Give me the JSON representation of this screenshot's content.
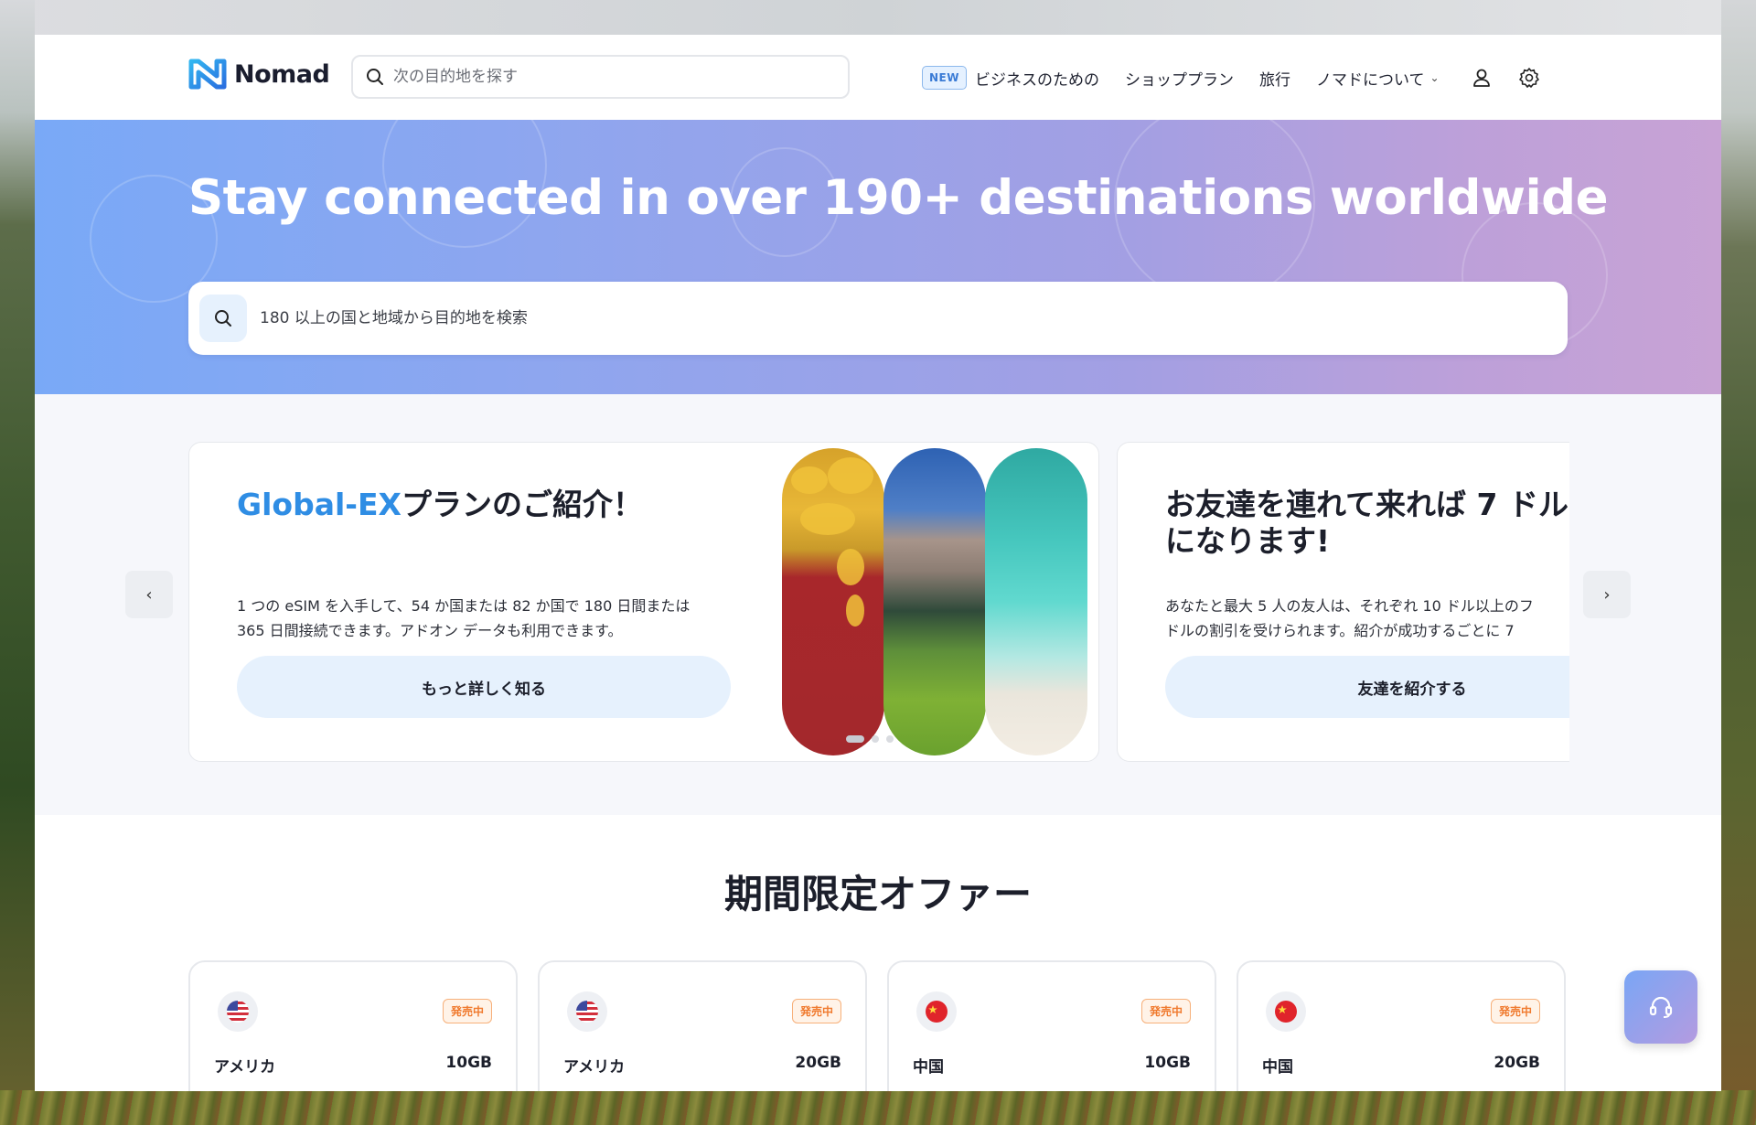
{
  "brand": {
    "name": "Nomad",
    "accent": "#2f8de4"
  },
  "header": {
    "search_placeholder": "次の目的地を探す",
    "new_badge": "NEW",
    "nav": [
      "ビジネスのための",
      "ショッププラン",
      "旅行",
      "ノマドについて"
    ]
  },
  "hero": {
    "title": "Stay connected in over 190+ destinations worldwide",
    "search_placeholder": "180 以上の国と地域から目的地を検索"
  },
  "promos": [
    {
      "title_accent": "Global-EX",
      "title_rest": "プランのご紹介！",
      "desc_line1": "1 つの eSIM を入手して、54 か国または 82 か国で 180 日間または",
      "desc_line2": "365 日間接続できます。アドオン データも利用できます。",
      "button": "もっと詳しく知る"
    },
    {
      "title_line1": "お友達を連れて来れば 7 ドル",
      "title_line2": "になります!",
      "desc_line1": "あなたと最大 5 人の友人は、それぞれ 10 ドル以上のフ",
      "desc_line2": "ドルの割引を受けられます。紹介が成功するごとに 7",
      "button": "友達を紹介する"
    }
  ],
  "offers": {
    "title": "期間限定オファー",
    "items": [
      {
        "country": "アメリカ",
        "data": "10GB",
        "badge": "発売中",
        "flag": "us-flag"
      },
      {
        "country": "アメリカ",
        "data": "20GB",
        "badge": "発売中",
        "flag": "us-flag"
      },
      {
        "country": "中国",
        "data": "10GB",
        "badge": "発売中",
        "flag": "cn-flag"
      },
      {
        "country": "中国",
        "data": "20GB",
        "badge": "発売中",
        "flag": "cn-flag"
      }
    ]
  }
}
